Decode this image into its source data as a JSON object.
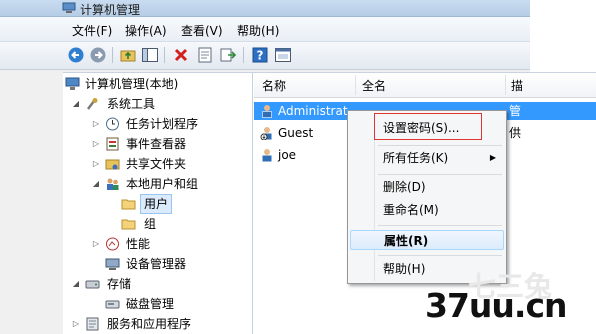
{
  "window": {
    "title": "计算机管理"
  },
  "menu": {
    "file": "文件(F)",
    "action": "操作(A)",
    "view": "查看(V)",
    "help": "帮助(H)"
  },
  "toolbar": {
    "icons": [
      "back-arrow-icon",
      "forward-arrow-icon",
      "up-folder-icon",
      "show-hide-tree-icon",
      "delete-icon",
      "properties-icon",
      "export-icon",
      "help-icon",
      "console-icon"
    ]
  },
  "tree": {
    "root": "计算机管理(本地)",
    "system_tools": "系统工具",
    "task_scheduler": "任务计划程序",
    "event_viewer": "事件查看器",
    "shared_folders": "共享文件夹",
    "local_users_groups": "本地用户和组",
    "users": "用户",
    "groups": "组",
    "performance": "性能",
    "device_manager": "设备管理器",
    "storage": "存储",
    "disk_management": "磁盘管理",
    "services_apps": "服务和应用程序"
  },
  "list": {
    "columns": [
      "名称",
      "全名",
      "描"
    ],
    "rows": [
      {
        "name": "Administrat...",
        "desc": "管"
      },
      {
        "name": "Guest",
        "desc": "供"
      },
      {
        "name": "joe",
        "desc": ""
      }
    ]
  },
  "context_menu": {
    "set_password": "设置密码(S)...",
    "all_tasks": "所有任务(K)",
    "delete": "删除(D)",
    "rename": "重命名(M)",
    "properties": "属性(R)",
    "help": "帮助(H)"
  },
  "watermark": {
    "text": "37uu.cn",
    "faint_text": "七三兔"
  },
  "colors": {
    "selection": "#3399ff",
    "highlight_box": "#e0342f",
    "menu_hover": "#dcebfc"
  }
}
